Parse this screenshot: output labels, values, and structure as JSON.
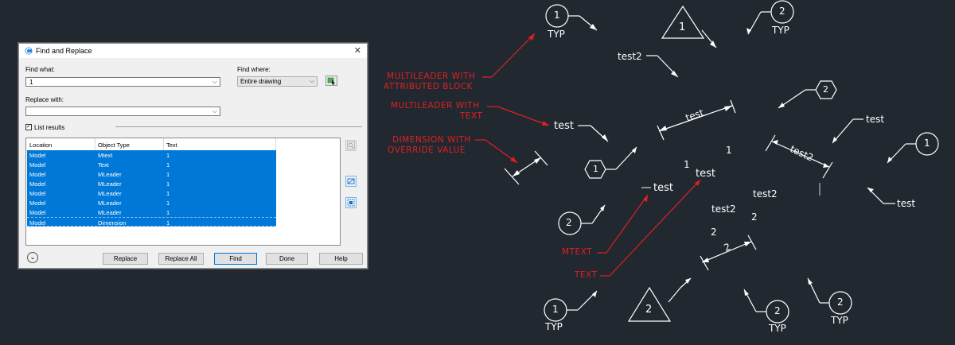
{
  "dialog": {
    "title": "Find and Replace",
    "find_what_label": "Find what:",
    "find_what_value": "1",
    "find_where_label": "Find where:",
    "find_where_value": "Entire drawing",
    "replace_with_label": "Replace with:",
    "replace_with_value": "",
    "list_results_label": "List results",
    "list_results_checked": true,
    "columns": [
      "Location",
      "Object Type",
      "Text"
    ],
    "rows": [
      {
        "location": "Model",
        "type": "Mtext",
        "text": "1"
      },
      {
        "location": "Model",
        "type": "Text",
        "text": "1"
      },
      {
        "location": "Model",
        "type": "MLeader",
        "text": "1"
      },
      {
        "location": "Model",
        "type": "MLeader",
        "text": "1"
      },
      {
        "location": "Model",
        "type": "MLeader",
        "text": "1"
      },
      {
        "location": "Model",
        "type": "MLeader",
        "text": "1"
      },
      {
        "location": "Model",
        "type": "MLeader",
        "text": "1"
      },
      {
        "location": "Model",
        "type": "Dimension",
        "text": "1"
      }
    ],
    "buttons": {
      "replace": "Replace",
      "replace_all": "Replace All",
      "find": "Find",
      "done": "Done",
      "help": "Help"
    },
    "selection_color": "#0078d7"
  },
  "drawing": {
    "background": "#212830",
    "annotation_color": "#e02020",
    "geometry_color": "#ffffff",
    "red_labels": {
      "mleader_attr_1": "MULTILEADER WITH",
      "mleader_attr_2": "ATTRIBUTED BLOCK",
      "mleader_text_1": "MULTILEADER WITH",
      "mleader_text_2": "TEXT",
      "dimension_1": "DIMENSION WITH",
      "dimension_2": "OVERRIDE VALUE",
      "mtext": "MTEXT",
      "text": "TEXT"
    },
    "texts": {
      "typ_top_left": "TYP",
      "typ_top_right": "TYP",
      "typ_bottom_left": "TYP",
      "typ_bottom_mid": "TYP",
      "typ_bottom_right": "TYP",
      "test2_top": "test2",
      "test_left": "test",
      "test_right_top": "test",
      "test_right_bottom": "test",
      "test_mid": "test",
      "test_mtext": "test",
      "test_center": "test",
      "test2_center_right": "test2",
      "test2_center": "test2",
      "dim_test": "test",
      "dim_test2": "test2",
      "dim_2": "2",
      "one_a": "1",
      "one_b": "1",
      "two_a": "2",
      "two_b": "2"
    },
    "symbols": {
      "circle_1_top": "1",
      "triangle_1": "1",
      "circle_2_top": "2",
      "hex_top_right": "2",
      "circle_1_right": "1",
      "hex_left": "1",
      "circle_2_left": "2",
      "circle_1_bottom": "1",
      "triangle_2": "2",
      "circle_2_bottom": "2",
      "circle_2_bottom_right": "2"
    }
  }
}
